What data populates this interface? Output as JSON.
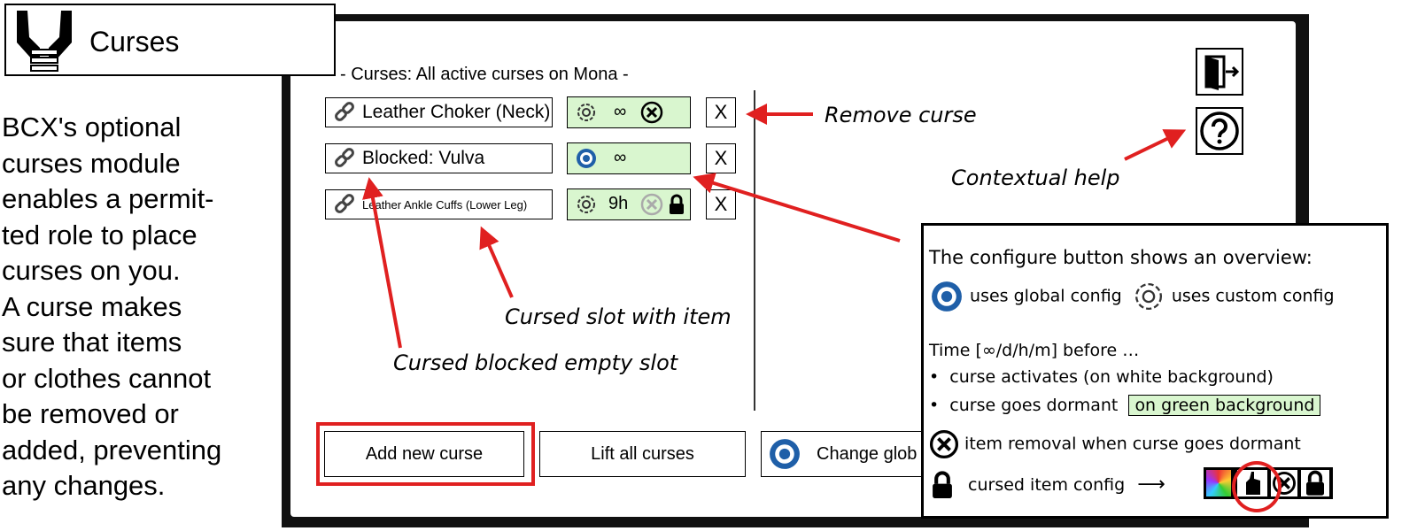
{
  "badge": {
    "title": "Curses",
    "icon": "bound-hands-icon"
  },
  "intro_lines": [
    "BCX's optional",
    "curses module",
    "enables a permit-",
    "ted role to place",
    "curses on you.",
    "A curse makes",
    "sure that items",
    "or clothes cannot",
    "be removed or",
    "added, preventing",
    "any changes."
  ],
  "panel": {
    "header": "- Curses: All active curses on Mona -",
    "curses": [
      {
        "item": "Leather Choker (Neck)",
        "config": "custom",
        "timer": "∞",
        "removal": "active",
        "locked": false,
        "remove_label": "X"
      },
      {
        "item": "Blocked: Vulva",
        "config": "global",
        "timer": "∞",
        "removal": "none",
        "locked": false,
        "remove_label": "X"
      },
      {
        "item": "Leather Ankle Cuffs (Lower Leg)",
        "config": "custom",
        "timer": "9h",
        "removal": "inactive",
        "locked": true,
        "remove_label": "X"
      }
    ],
    "buttons": {
      "add": "Add new curse",
      "lift": "Lift all curses",
      "change_global": "Change glob"
    }
  },
  "annotations": {
    "remove_curse": "Remove curse",
    "contextual_help": "Contextual help",
    "cursed_slot_item": "Cursed slot with item",
    "cursed_blocked_slot": "Cursed blocked empty slot"
  },
  "info_box": {
    "heading": "The configure button shows an overview:",
    "global_config": "uses global config",
    "custom_config": "uses custom config",
    "time_line": "Time [∞/d/h/m] before …",
    "bullet_activates": "curse activates (on white background)",
    "bullet_dormant": "curse goes dormant",
    "green_label": "on green background",
    "removal_line": "item removal when curse goes dormant",
    "cursed_config": "cursed item config",
    "arrow": "⟶"
  },
  "colors": {
    "highlight_red": "#e02020",
    "config_green": "#d9f6cf",
    "gear_blue": "#1f5fa8"
  }
}
